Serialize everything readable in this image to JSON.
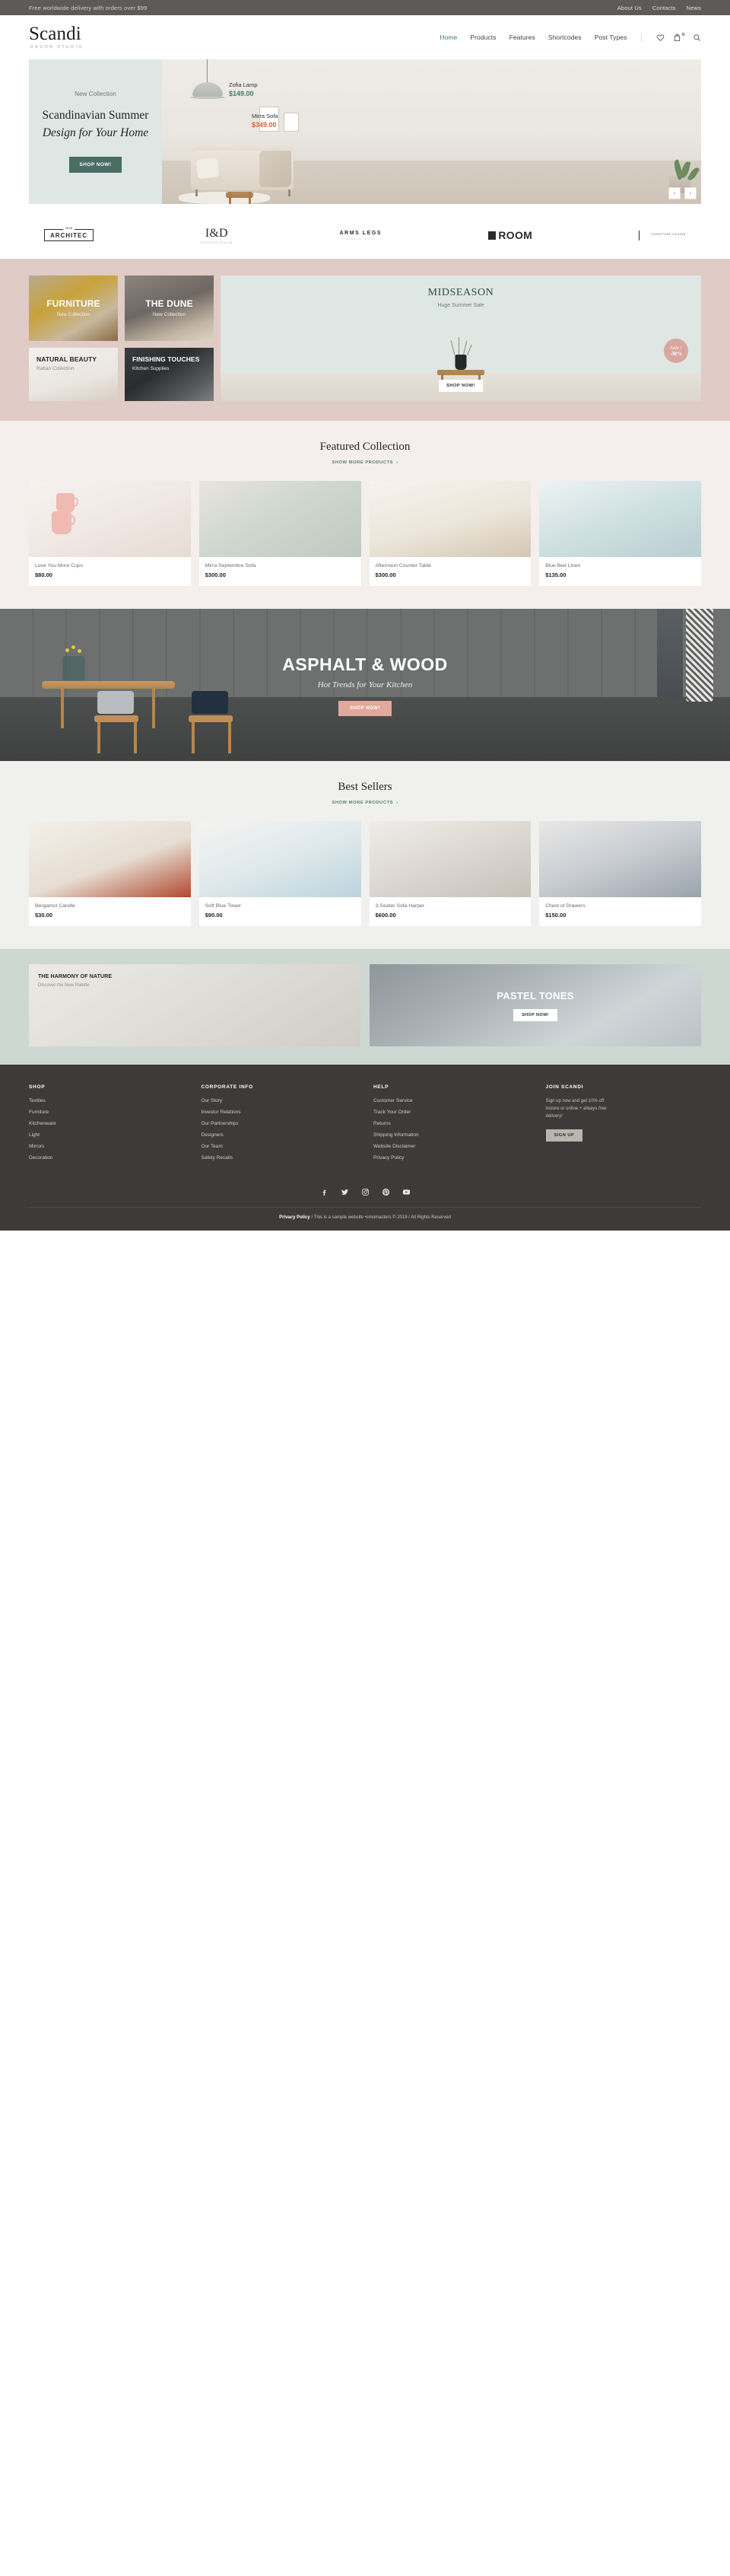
{
  "topbar": {
    "promo": "Free worldwide delivery with orders over $99",
    "links": [
      "About Us",
      "Contacts",
      "News"
    ]
  },
  "header": {
    "brand_name": "Scandi",
    "brand_sub": "DECOR STUDIO",
    "nav": [
      {
        "label": "Home",
        "active": true
      },
      {
        "label": "Products",
        "active": false
      },
      {
        "label": "Features",
        "active": false
      },
      {
        "label": "Shortcodes",
        "active": false
      },
      {
        "label": "Post Types",
        "active": false
      }
    ],
    "cart_count": "0",
    "icons": [
      "heart-icon",
      "cart-icon",
      "search-icon"
    ]
  },
  "hero": {
    "eyebrow": "New Collection",
    "title_line1": "Scandinavian Summer",
    "title_line2": "Design for Your Home",
    "cta": "SHOP NOW!",
    "tags": [
      {
        "name": "Zofia Lamp",
        "price": "$149.00",
        "color": "#3f7a6e"
      },
      {
        "name": "Mirra Sofa",
        "price": "$349.00",
        "color": "#d9603c"
      }
    ],
    "prev_arrow": "‹",
    "next_arrow": "›"
  },
  "brands": [
    {
      "name": "ARCHITEC",
      "year": "2016"
    },
    {
      "name": "I&D",
      "sub": "INTERIOR DESIGN"
    },
    {
      "name": "ARMS LEGS",
      "sub": "INTERIOR DESIGN"
    },
    {
      "name": "ROOM"
    },
    {
      "name": "FURNITURE DESIGN"
    }
  ],
  "categories": [
    {
      "title": "FURNITURE",
      "sub": "New Collection",
      "style": "light"
    },
    {
      "title": "THE DUNE",
      "sub": "New Collection",
      "style": "light"
    },
    {
      "title": "NATURAL BEAUTY",
      "sub": "Rattan Collection",
      "style": "dark"
    },
    {
      "title": "FINISHING TOUCHES",
      "sub": "Kitchen Supplies",
      "style": "light"
    }
  ],
  "promo": {
    "title": "MIDSEASON",
    "sub": "Huge Summer Sale",
    "badge_line1": "Sale !",
    "badge_line2": "-30%",
    "cta": "SHOP NOW!"
  },
  "featured": {
    "title": "Featured Collection",
    "more_label": "SHOW MORE PRODUCTS",
    "more_arrow": "›",
    "products": [
      {
        "name": "Love You More Cups",
        "price": "$80.00",
        "img": "img-cups"
      },
      {
        "name": "Mirra Septembre Sofa",
        "price": "$300.00",
        "img": "img-sofa"
      },
      {
        "name": "Afternoon Counter Table",
        "price": "$300.00",
        "img": "img-table"
      },
      {
        "name": "Blue Bed Linen",
        "price": "$135.00",
        "img": "img-linen"
      }
    ]
  },
  "banner": {
    "title": "ASPHALT & WOOD",
    "sub": "Hot Trends for Your Kitchen",
    "cta": "SHOP NOW!"
  },
  "bestsellers": {
    "title": "Best Sellers",
    "more_label": "SHOW MORE PRODUCTS",
    "more_arrow": "›",
    "products": [
      {
        "name": "Bergamot Candle",
        "price": "$30.00",
        "img": "img-candle"
      },
      {
        "name": "Soft Blue Towel",
        "price": "$90.00",
        "img": "img-towel"
      },
      {
        "name": "3-Seater Sofa Harper",
        "price": "$600.00",
        "img": "img-harper"
      },
      {
        "name": "Chest of Drawers",
        "price": "$150.00",
        "img": "img-chest"
      }
    ]
  },
  "promo_bottom": [
    {
      "title": "THE HARMONY OF NATURE",
      "sub": "Discover the New Palette",
      "layout": "left"
    },
    {
      "title": "PASTEL TONES",
      "cta": "SHOP NOW!",
      "layout": "center"
    }
  ],
  "footer": {
    "columns": [
      {
        "head": "SHOP",
        "items": [
          "Textiles",
          "Furniture",
          "Kitchenware",
          "Light",
          "Mirrors",
          "Decoration"
        ]
      },
      {
        "head": "CORPORATE INFO",
        "items": [
          "Our Story",
          "Investor Relations",
          "Our Partnerships",
          "Designers",
          "Our Team",
          "Safety Recalls"
        ]
      },
      {
        "head": "HELP",
        "items": [
          "Customer Service",
          "Track Your Order",
          "Returns",
          "Shipping Information",
          "Website Disclaimer",
          "Privacy Policy"
        ]
      }
    ],
    "join": {
      "head": "JOIN SCANDI",
      "text": "Sign up now and get 10% off instore or online + always free delivery!",
      "cta": "SIGN UP"
    },
    "social": [
      "facebook-icon",
      "twitter-icon",
      "instagram-icon",
      "pinterest-icon",
      "youtube-icon"
    ],
    "legal_link": "Privacy Policy",
    "legal_text": "/ This is a sample website •cmomasters © 2019 / All Rights Reserved"
  },
  "colors": {
    "accent_teal": "#3f7a6e",
    "accent_orange": "#d9603c",
    "band_pink": "#e0cbc6",
    "band_sage": "#cdd8d2",
    "hero_bg": "#dfe7e5",
    "footer_bg": "#3d3b39"
  }
}
